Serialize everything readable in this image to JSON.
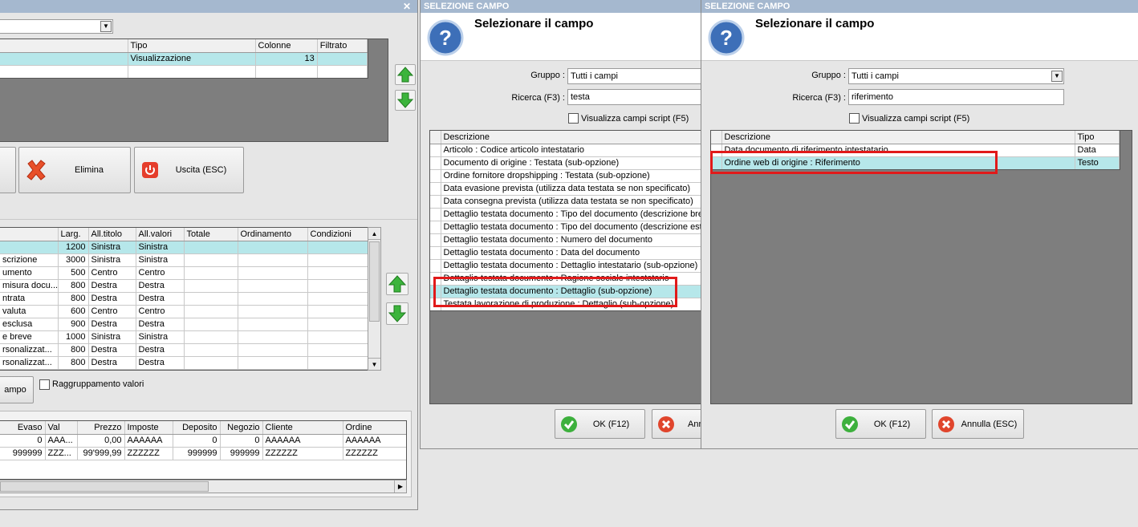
{
  "left": {
    "top_table": {
      "headers": [
        "Tipo",
        "Colonne",
        "Filtrato"
      ],
      "rows": [
        [
          "Visualizzazione",
          "13",
          ""
        ]
      ]
    },
    "buttons": {
      "delete": "Elimina",
      "exit": "Uscita (ESC)",
      "field": "ampo"
    },
    "mid_table": {
      "headers": [
        "",
        "Larg.",
        "All.titolo",
        "All.valori",
        "Totale",
        "Ordinamento",
        "Condizioni"
      ],
      "rows": [
        [
          "",
          "1200",
          "Sinistra",
          "Sinistra"
        ],
        [
          "scrizione",
          "3000",
          "Sinistra",
          "Sinistra"
        ],
        [
          "umento",
          "500",
          "Centro",
          "Centro"
        ],
        [
          "misura docu...",
          "800",
          "Destra",
          "Destra"
        ],
        [
          "ntrata",
          "800",
          "Destra",
          "Destra"
        ],
        [
          "valuta",
          "600",
          "Centro",
          "Centro"
        ],
        [
          "esclusa",
          "900",
          "Destra",
          "Destra"
        ],
        [
          "e breve",
          "1000",
          "Sinistra",
          "Sinistra"
        ],
        [
          "rsonalizzat...",
          "800",
          "Destra",
          "Destra"
        ],
        [
          "rsonalizzat...",
          "800",
          "Destra",
          "Destra"
        ]
      ]
    },
    "group_values_label": "Raggruppamento valori",
    "bottom_table": {
      "headers": [
        "Evaso",
        "Val",
        "Prezzo",
        "Imposte",
        "Deposito",
        "Negozio",
        "Cliente",
        "Ordine"
      ],
      "rows": [
        [
          "0",
          "AAA...",
          "0,00",
          "AAAAAA",
          "0",
          "0",
          "AAAAAA",
          "AAAAAA"
        ],
        [
          "999999",
          "ZZZ...",
          "99'999,99",
          "ZZZZZZ",
          "999999",
          "999999",
          "ZZZZZZ",
          "ZZZZZZ"
        ]
      ]
    }
  },
  "dialog1": {
    "window_title": "SELEZIONE CAMPO",
    "heading": "Selezionare il campo",
    "group_label": "Gruppo :",
    "group_value": "Tutti i campi",
    "search_label": "Ricerca (F3) :",
    "search_value": "testa",
    "script_label": "Visualizza campi script (F5)",
    "table_header": "Descrizione",
    "rows": [
      "Articolo : Codice articolo intestatario",
      "Documento di origine : Testata (sub-opzione)",
      "Ordine fornitore dropshipping : Testata (sub-opzione)",
      "Data evasione prevista (utilizza data testata se non specificato)",
      "Data consegna prevista (utilizza data testata se non specificato)",
      "Dettaglio testata documento : Tipo del documento (descrizione brev",
      "Dettaglio testata documento : Tipo del documento (descrizione este",
      "Dettaglio testata documento : Numero del documento",
      "Dettaglio testata documento : Data del documento",
      "Dettaglio testata documento : Dettaglio intestatario (sub-opzione)",
      "Dettaglio testata documento : Ragione sociale intestatario",
      "Dettaglio testata documento : Dettaglio (sub-opzione)",
      "Testata lavorazione di produzione : Dettaglio (sub-opzione)"
    ],
    "ok": "OK (F12)",
    "cancel": "Annu"
  },
  "dialog2": {
    "window_title": "SELEZIONE CAMPO",
    "heading": "Selezionare il campo",
    "group_label": "Gruppo :",
    "group_value": "Tutti i campi",
    "search_label": "Ricerca (F3) :",
    "search_value": "riferimento",
    "script_label": "Visualizza campi script (F5)",
    "headers": [
      "Descrizione",
      "Tipo"
    ],
    "rows": [
      [
        "Data documento di riferimento intestatario",
        "Data"
      ],
      [
        "Ordine web di origine : Riferimento",
        "Testo"
      ]
    ],
    "ok": "OK (F12)",
    "cancel": "Annulla (ESC)"
  },
  "colors": {
    "selection": "#b6e7ea",
    "highlight_box": "#e11a1a",
    "titlebar": "#a5b8cf"
  }
}
